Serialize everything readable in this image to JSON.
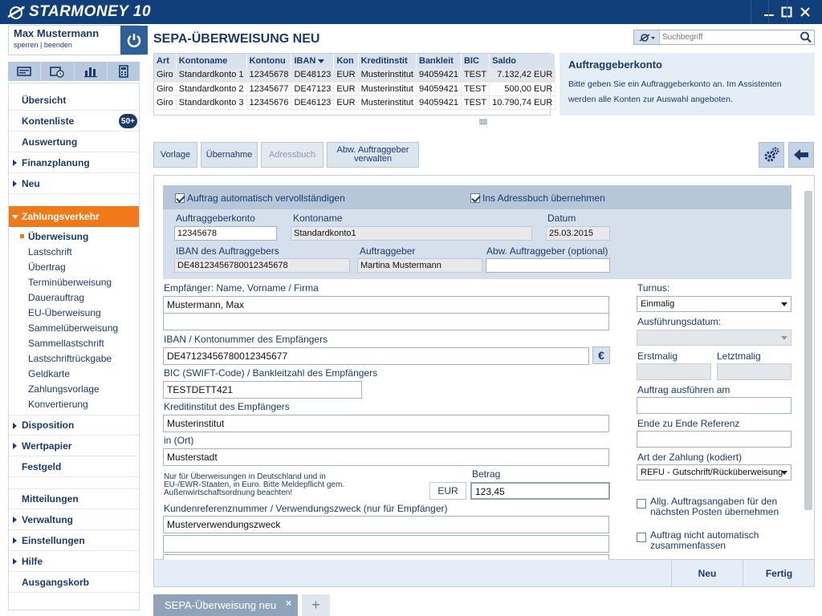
{
  "app": {
    "brand": "STARMONEY 10"
  },
  "user": {
    "name": "Max Mustermann",
    "links": "sperren | beenden"
  },
  "nav": {
    "items": [
      {
        "label": "Übersicht",
        "arrow": false
      },
      {
        "label": "Kontenliste",
        "arrow": false,
        "badge": "50+"
      },
      {
        "label": "Auswertung",
        "arrow": false
      },
      {
        "label": "Finanzplanung",
        "arrow": true
      },
      {
        "label": "Neu",
        "arrow": true
      }
    ],
    "active": {
      "label": "Zahlungsverkehr"
    },
    "sub_items": [
      "Überweisung",
      "Lastschrift",
      "Übertrag",
      "Terminüberweisung",
      "Dauerauftrag",
      "EU-Überweisung",
      "Sammelüberweisung",
      "Sammellastschrift",
      "Lastschriftrückgabe",
      "Geldkarte",
      "Zahlungsvorlage",
      "Konvertierung"
    ],
    "lower_items": [
      {
        "label": "Disposition",
        "arrow": true
      },
      {
        "label": "Wertpapier",
        "arrow": true
      },
      {
        "label": "Festgeld",
        "arrow": false
      },
      {
        "label": "Mitteilungen",
        "arrow": false
      },
      {
        "label": "Verwaltung",
        "arrow": true
      },
      {
        "label": "Einstellungen",
        "arrow": true
      },
      {
        "label": "Hilfe",
        "arrow": true
      },
      {
        "label": "Ausgangskorb",
        "arrow": false
      }
    ]
  },
  "header": {
    "title": "SEPA-ÜBERWEISUNG NEU",
    "search_placeholder": "Suchbegriff"
  },
  "accounts": {
    "columns": [
      "Art",
      "Kontoname",
      "Kontonu",
      "IBAN",
      "Kon",
      "Kreditinstit",
      "Bankleit",
      "BIC",
      "Saldo"
    ],
    "rows": [
      [
        "Giro",
        "Standardkonto 1",
        "12345678",
        "DE48123",
        "EUR",
        "Musterinstitut",
        "94059421",
        "TEST",
        "7.132,42 EUR"
      ],
      [
        "Giro",
        "Standardkonto 2",
        "12345677",
        "DE47123",
        "EUR",
        "Musterinstitut",
        "94059421",
        "TEST",
        "500,00 EUR"
      ],
      [
        "Giro",
        "Standardkonto 3",
        "12345676",
        "DE46123",
        "EUR",
        "Musterinstitut",
        "94059421",
        "TEST",
        "10.790,74 EUR"
      ]
    ]
  },
  "info": {
    "title": "Auftraggeberkonto",
    "text": "Bitte geben Sie ein Auftraggeberkonto an. Im Assistenten werden alle Konten zur Auswahl angeboten."
  },
  "toolbar": {
    "vorlage": "Vorlage",
    "uebernahme": "Übernahme",
    "adressbuch": "Adressbuch",
    "abw_line1": "Abw. Auftraggeber",
    "abw_line2": "verwalten"
  },
  "form": {
    "auto_complete": "Auftrag automatisch vervollständigen",
    "to_addressbook": "Ins Adressbuch übernehmen",
    "sender_account_label": "Auftraggeberkonto",
    "sender_account": "12345678",
    "account_name_label": "Kontoname",
    "account_name": "Standardkonto1",
    "date_label": "Datum",
    "date": "25.03.2015",
    "iban_sender_label": "IBAN des Auftraggebers",
    "iban_sender": "DE48123456780012345678",
    "sender_label": "Auftraggeber",
    "sender": "Martina Mustermann",
    "abw_sender_label": "Abw. Auftraggeber (optional)",
    "abw_sender": "",
    "recipient_label": "Empfänger: Name, Vorname / Firma",
    "recipient": "Mustermann, Max",
    "recipient2": "",
    "iban_label": "IBAN / Kontonummer des Empfängers",
    "iban": "DE47123456780012345677",
    "euro_symbol": "€",
    "bic_label": "BIC (SWIFT-Code) / Bankleitzahl des Empfängers",
    "bic": "TESTDETT421",
    "bank_label": "Kreditinstitut des Empfängers",
    "bank": "Musterinstitut",
    "city_label": "in (Ort)",
    "city": "Musterstadt",
    "note": "Nur für Überweisungen in Deutschland und in EU-/EWR-Staaten, in Euro. Bitte Meldepflicht gem. Außenwirtschaftsordnung beachten!",
    "currency": "EUR",
    "amount_label": "Betrag",
    "amount": "123,45",
    "purpose_label": "Kundenreferenznummer / Verwendungszweck (nur für Empfänger)",
    "purpose1": "Musterverwendungszweck",
    "purpose2": "",
    "turnus_label": "Turnus:",
    "turnus": "Einmalig",
    "exec_date_label": "Ausführungsdatum:",
    "exec_date": "",
    "first_label": "Erstmalig",
    "last_label": "Letztmalig",
    "exec_on_label": "Auftrag ausführen am",
    "e2e_label": "Ende zu Ende Referenz",
    "pay_type_label": "Art der Zahlung (kodiert)",
    "pay_type": "REFU - Gutschrift/Rücküberweisung",
    "opt1": "Allg. Auftragsangaben für den nächsten Posten übernehmen",
    "opt2": "Auftrag nicht automatisch zusammenfassen"
  },
  "footer": {
    "neu": "Neu",
    "fertig": "Fertig"
  },
  "tabs": {
    "active": "SEPA-Überweisung neu",
    "add": "+"
  }
}
